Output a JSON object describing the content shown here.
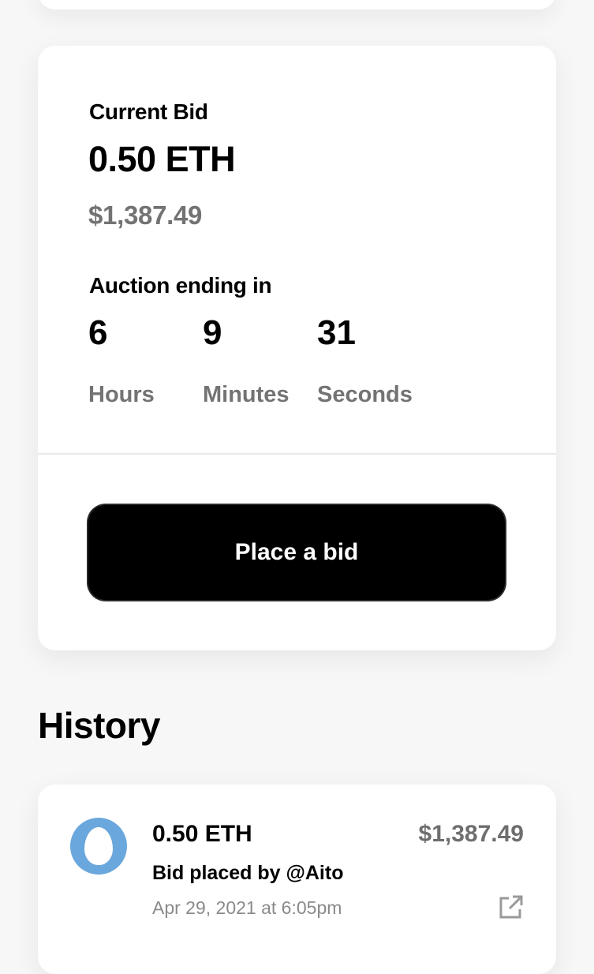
{
  "current_bid": {
    "label": "Current Bid",
    "eth": "0.50 ETH",
    "usd": "$1,387.49"
  },
  "auction": {
    "label": "Auction ending in",
    "countdown": [
      {
        "value": "6",
        "unit": "Hours"
      },
      {
        "value": "9",
        "unit": "Minutes"
      },
      {
        "value": "31",
        "unit": "Seconds"
      }
    ]
  },
  "actions": {
    "place_bid_label": "Place a bid"
  },
  "history": {
    "title": "History",
    "items": [
      {
        "amount_eth": "0.50 ETH",
        "amount_usd": "$1,387.49",
        "placed_by_prefix": "Bid placed by",
        "user": "@Aito",
        "date": "Apr 29, 2021 at 6:05pm",
        "avatar_color": "#6aa7dc",
        "icon": "external-link-icon"
      }
    ]
  }
}
